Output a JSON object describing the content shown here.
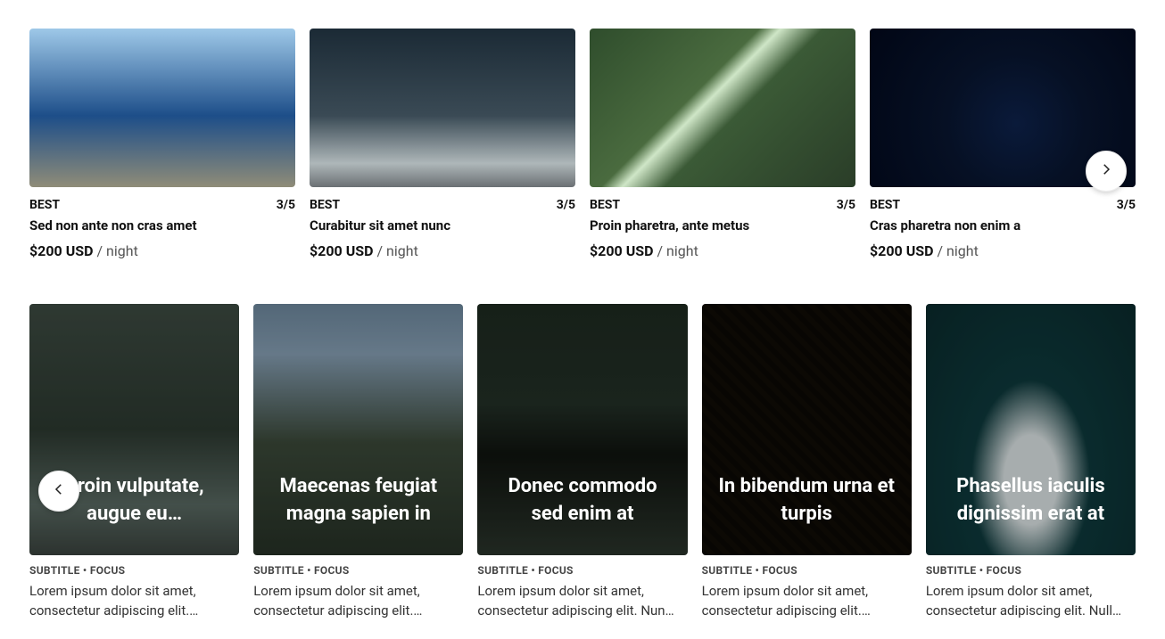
{
  "nav": {
    "next_label": "Next",
    "prev_label": "Previous"
  },
  "row1": {
    "cards": [
      {
        "badge": "BEST",
        "rating": "3/5",
        "title": "Sed non ante non cras amet",
        "price_amount": "$200 USD",
        "price_per": "/ night"
      },
      {
        "badge": "BEST",
        "rating": "3/5",
        "title": "Curabitur sit amet nunc",
        "price_amount": "$200 USD",
        "price_per": "/ night"
      },
      {
        "badge": "BEST",
        "rating": "3/5",
        "title": "Proin pharetra, ante metus",
        "price_amount": "$200 USD",
        "price_per": "/ night"
      },
      {
        "badge": "BEST",
        "rating": "3/5",
        "title": "Cras pharetra non enim a",
        "price_amount": "$200 USD",
        "price_per": "/ night"
      }
    ]
  },
  "row2": {
    "cards": [
      {
        "hero_title": "Proin vulputate, augue eu…",
        "subtitle": "SUBTITLE • FOCUS",
        "desc": "Lorem ipsum dolor sit amet, consectetur adipiscing elit.…"
      },
      {
        "hero_title": "Maecenas feugiat magna sapien in",
        "subtitle": "SUBTITLE • FOCUS",
        "desc": "Lorem ipsum dolor sit amet, consectetur adipiscing elit.…"
      },
      {
        "hero_title": "Donec commodo sed enim at",
        "subtitle": "SUBTITLE • FOCUS",
        "desc": "Lorem ipsum dolor sit amet, consectetur adipiscing elit. Nun…"
      },
      {
        "hero_title": "In bibendum urna et turpis",
        "subtitle": "SUBTITLE • FOCUS",
        "desc": "Lorem ipsum dolor sit amet, consectetur adipiscing elit.…"
      },
      {
        "hero_title": "Phasellus iaculis dignissim erat at",
        "subtitle": "SUBTITLE • FOCUS",
        "desc": "Lorem ipsum dolor sit amet, consectetur adipiscing elit. Null…"
      }
    ]
  }
}
